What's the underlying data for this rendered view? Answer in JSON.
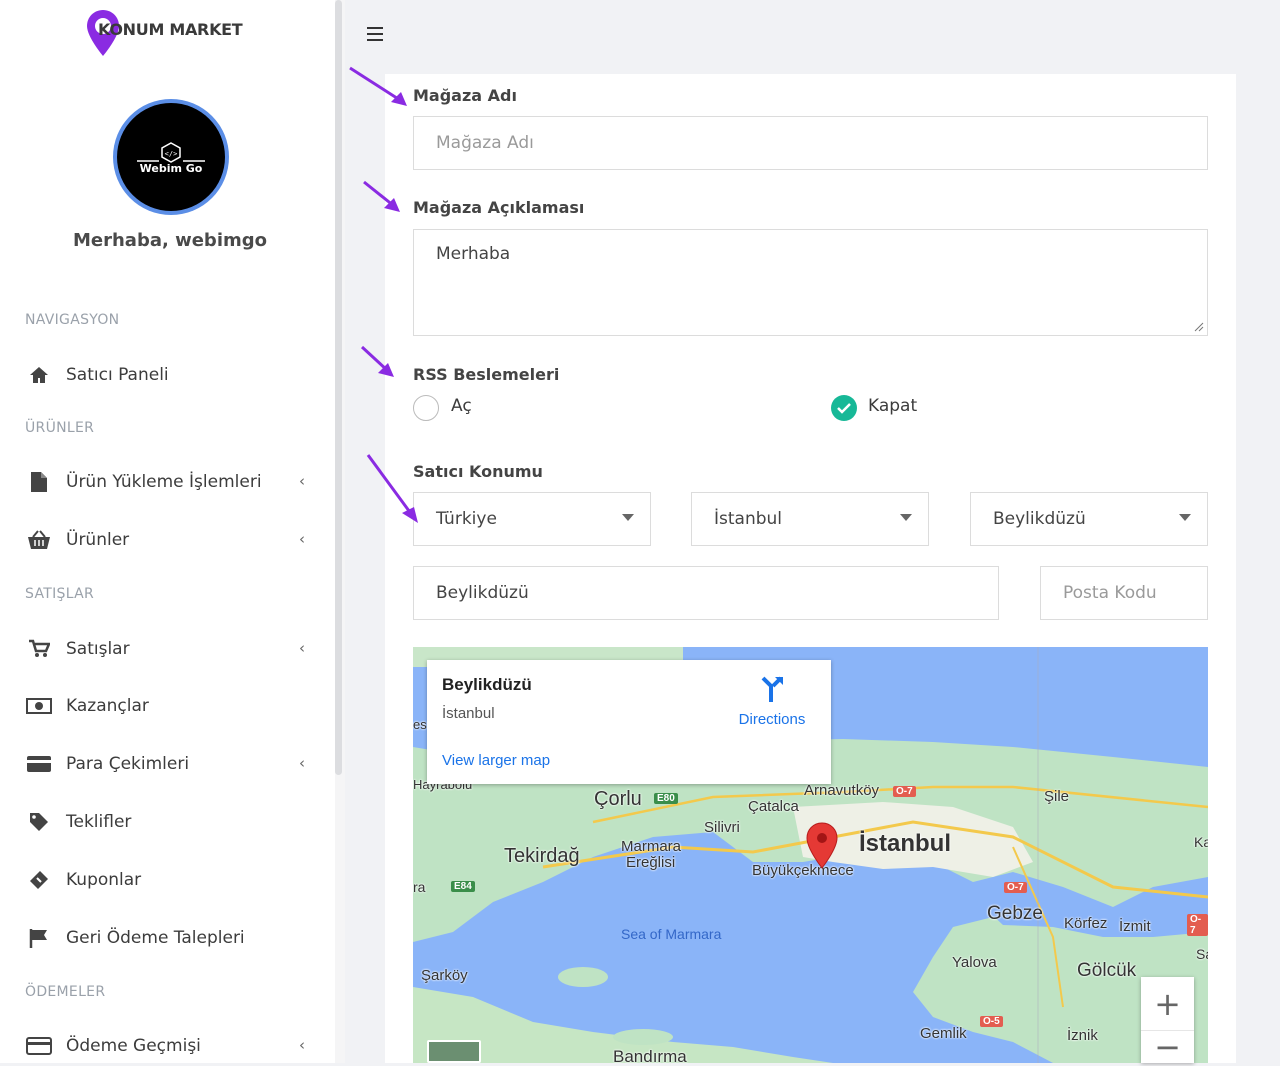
{
  "brand": {
    "logo_text": "KONUM MARKET",
    "avatar_text": "Webim Go"
  },
  "user": {
    "greeting": "Merhaba, webimgo"
  },
  "nav": {
    "sections": [
      "NAVIGASYON",
      "ÜRÜNLER",
      "SATIŞLAR",
      "ÖDEMELER"
    ],
    "items": [
      {
        "label": "Satıcı Paneli",
        "icon": "home-icon"
      },
      {
        "label": "Ürün Yükleme İşlemleri",
        "icon": "file-icon"
      },
      {
        "label": "Ürünler",
        "icon": "basket-icon"
      },
      {
        "label": "Satışlar",
        "icon": "cart-icon"
      },
      {
        "label": "Kazançlar",
        "icon": "money-icon"
      },
      {
        "label": "Para Çekimleri",
        "icon": "credit-card-icon"
      },
      {
        "label": "Teklifler",
        "icon": "tag-icon"
      },
      {
        "label": "Kuponlar",
        "icon": "ticket-icon"
      },
      {
        "label": "Geri Ödeme Talepleri",
        "icon": "flag-icon"
      },
      {
        "label": "Ödeme Geçmişi",
        "icon": "credit-card-icon"
      }
    ]
  },
  "form": {
    "store_name": {
      "label": "Mağaza Adı",
      "placeholder": "Mağaza Adı"
    },
    "store_desc": {
      "label": "Mağaza Açıklaması",
      "value": "Merhaba"
    },
    "rss": {
      "label": "RSS Beslemeleri",
      "open": "Aç",
      "close": "Kapat",
      "selected": "Kapat"
    },
    "location": {
      "label": "Satıcı Konumu",
      "country": "Türkiye",
      "city": "İstanbul",
      "district": "Beylikdüzü",
      "address": "Beylikdüzü",
      "postal_placeholder": "Posta Kodu"
    }
  },
  "map": {
    "info_title": "Beylikdüzü",
    "info_subtitle": "İstanbul",
    "directions": "Directions",
    "larger_map": "View larger map",
    "labels": {
      "hayrabolu": "Hayrabolu",
      "corlu": "Çorlu",
      "arnavutkoy": "Arnavutköy",
      "sile": "Şile",
      "catalca": "Çatalca",
      "silivri": "Silivri",
      "marmara_ereglisi_1": "Marmara",
      "marmara_ereglisi_2": "Ereğlisi",
      "tekirdag": "Tekirdağ",
      "istanbul": "İstanbul",
      "buyukcekmece": "Büyükçekmece",
      "gebze": "Gebze",
      "korfez": "Körfez",
      "izmit": "İzmit",
      "sea": "Sea of Marmara",
      "yalova": "Yalova",
      "golcuk": "Gölcük",
      "sarkoy": "Şarköy",
      "gemlik": "Gemlik",
      "iznik": "İznik",
      "bandirma": "Bandırma",
      "ka": "Ka",
      "sap": "Sap",
      "es": "es",
      "ra": "ra"
    },
    "shields": {
      "e80": "E80",
      "e84": "E84",
      "o7a": "O-7",
      "o7b": "O-7",
      "o7c": "O-7",
      "o5": "O-5"
    },
    "zoom_in": "+",
    "zoom_out": "−"
  },
  "colors": {
    "accent": "#8a2be2",
    "check": "#17b897",
    "map_water": "#8ab4f8",
    "map_land": "#bde2c6",
    "pin": "#e53935"
  }
}
